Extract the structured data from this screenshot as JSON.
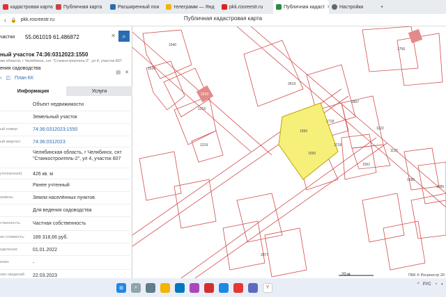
{
  "browser": {
    "tabs": [
      {
        "label": "кадастровая карта",
        "color": "#d33"
      },
      {
        "label": "Публичная карта",
        "color": "#c44"
      },
      {
        "label": "Расширенный пои",
        "color": "#2b6cb0"
      },
      {
        "label": "телеграмм — Янд",
        "color": "#f2b400"
      },
      {
        "label": "pkk.rosreestr.ru",
        "color": "#e02020"
      },
      {
        "label": "Публичная кадаст",
        "color": "#2b8a3e"
      },
      {
        "label": "Настройки",
        "color": "#666"
      }
    ],
    "url": "pkk.rosreestr.ru",
    "page_title": "Публичная кадастровая карта"
  },
  "sidebar": {
    "search_label": "частки",
    "search_value": "55.061019 61.486872",
    "object_title": "ный участок 74:36:0312023:1550",
    "object_address": "ом области, г Челябинск, снт \"Станкостроитель-2\", ул 4, участок 807",
    "object_type": "ения садоводства",
    "plan_label": "План КК",
    "tab_info": "Информация",
    "tab_services": "Услуги",
    "rows": [
      {
        "k": "",
        "v": "Объект недвижимости",
        "link": false
      },
      {
        "k": "",
        "v": "Земельный участок",
        "link": false
      },
      {
        "k": "ый номер:",
        "v": "74:36:0312023:1550",
        "link": true
      },
      {
        "k": "ый квартал:",
        "v": "74:36:0312023",
        "link": true
      },
      {
        "k": "",
        "v": "Челябинская область, г Челябинск, снт \"Станкостроитель-2\", ул 4, участок 807",
        "link": false
      },
      {
        "k": "уточненная):",
        "v": "426 кв. м",
        "link": false
      },
      {
        "k": "",
        "v": "Ранее учтенный",
        "link": false
      },
      {
        "k": "земель:",
        "v": "Земли населённых пунктов",
        "link": false
      },
      {
        "k": "",
        "v": "Для ведения садоводства",
        "link": false
      },
      {
        "k": "ственность:",
        "v": "Частная собственность",
        "link": false
      },
      {
        "k": "ая стоимость:",
        "v": "189 318,66 руб.",
        "link": false
      },
      {
        "k": "еделения:",
        "v": "01.01.2022",
        "link": false
      },
      {
        "k": "ения:",
        "v": "-",
        "link": false
      },
      {
        "k": "ния сведений:",
        "v": "22.03.2023",
        "link": false
      }
    ]
  },
  "map": {
    "labels": [
      "1540",
      "1520",
      "2019",
      "1216",
      "1219",
      "2619",
      "1807",
      "1718",
      "1718",
      "1550",
      "1550",
      "1122",
      "1122",
      "1551",
      "1685",
      "1685",
      "2077",
      "1756",
      "1676"
    ],
    "scale_label": "20 м",
    "copyright": "ПКК © Росреестр 20",
    "highlight_color": "#f6f07a"
  },
  "taskbar": {
    "lang": "РУС"
  }
}
